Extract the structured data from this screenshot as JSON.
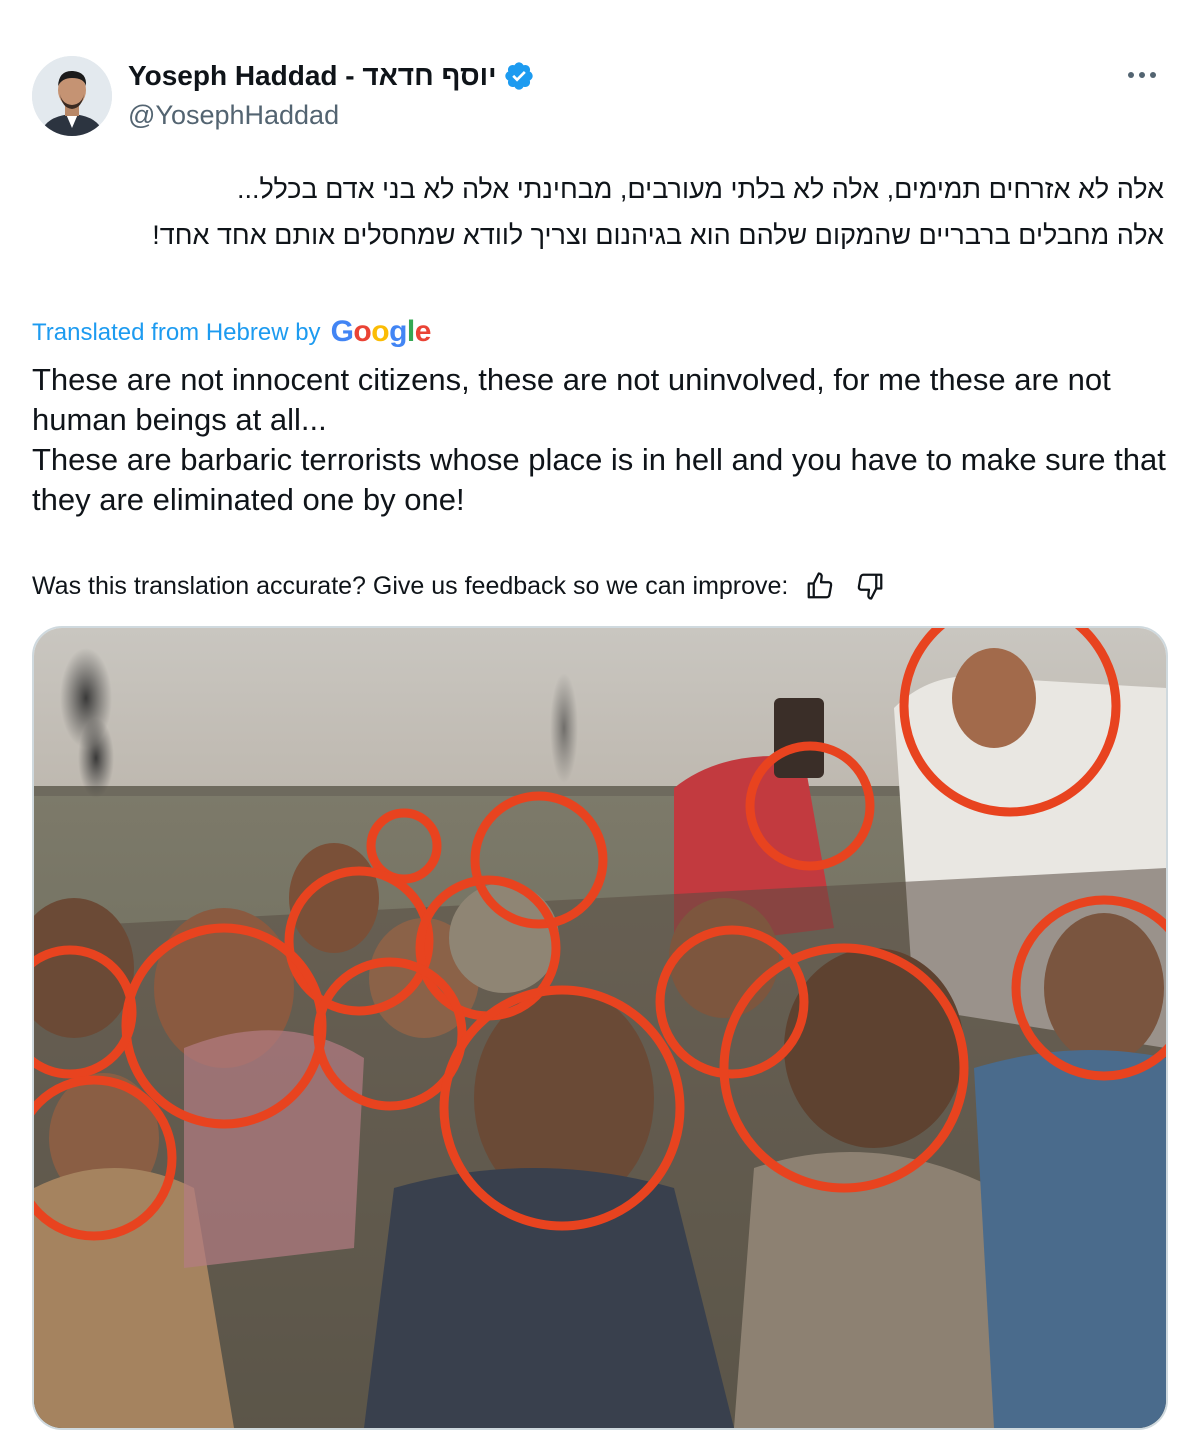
{
  "author": {
    "display_name": "יוסף חדאד - Yoseph Haddad",
    "handle": "@YosephHaddad",
    "verified": true
  },
  "icons": {
    "verified": "verified-badge-icon",
    "more": "more-options-icon",
    "thumbs_up": "thumbs-up-icon",
    "thumbs_down": "thumbs-down-icon"
  },
  "post": {
    "original_text": "אלה לא אזרחים תמימים, אלה לא בלתי מעורבים, מבחינתי אלה לא בני אדם בכלל...\nאלה מחבלים ברבריים שהמקום שלהם הוא בגיהנום וצריך לוודא שמחסלים אותם אחד אחד!",
    "translation_label": "Translated from Hebrew by",
    "translation_provider": "Google",
    "translated_text_line1": "These are not innocent citizens, these are not uninvolved, for me these are not human beings at all...",
    "translated_text_line2": "These are barbaric terrorists whose place is in hell and you have to make sure that they are eliminated one by one!",
    "feedback_prompt": "Was this translation accurate? Give us feedback so we can improve:"
  },
  "colors": {
    "accent": "#1d9bf0",
    "verified": "#1d9bf0",
    "circle_annotation": "#e8431f",
    "secondary_text": "#536471"
  },
  "media": {
    "type": "photo",
    "annotation_circle_count": 17
  }
}
